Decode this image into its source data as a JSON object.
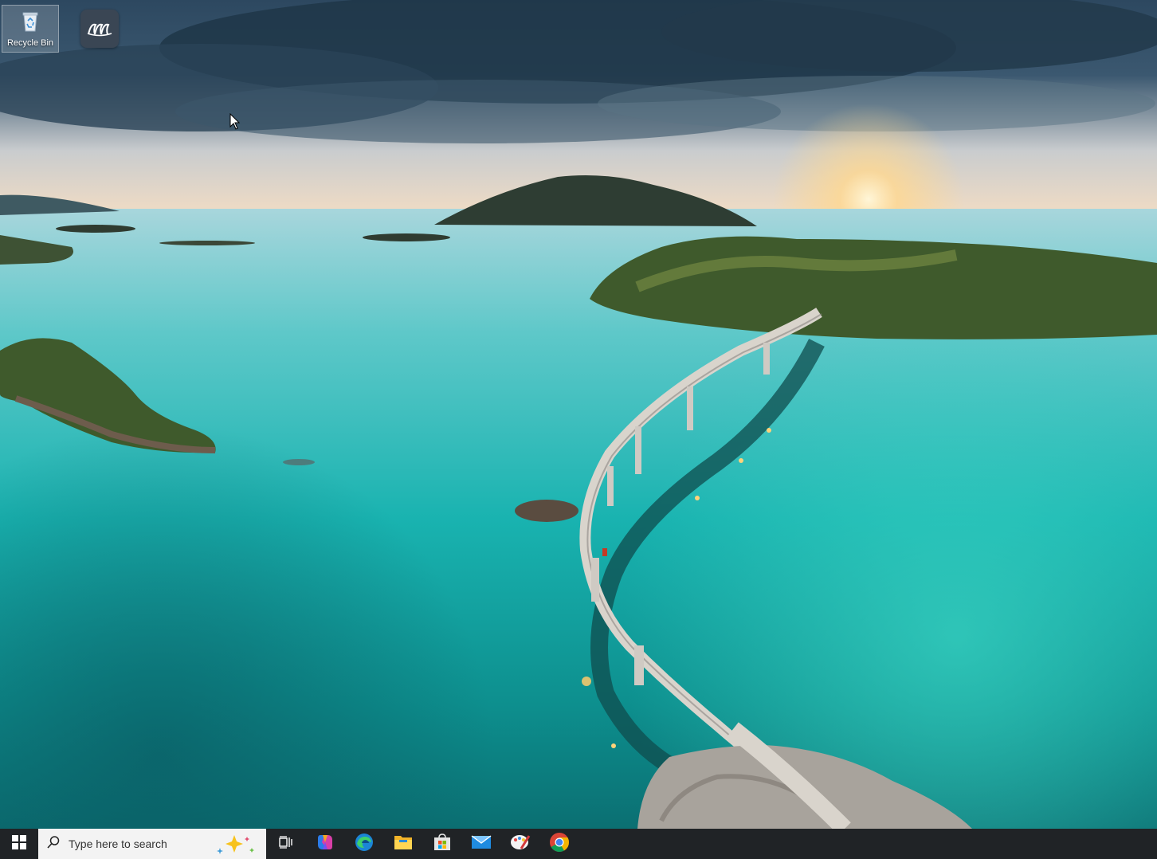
{
  "desktop": {
    "icons": [
      {
        "label": "Recycle Bin",
        "icon": "recycle-bin-icon"
      },
      {
        "label": "",
        "icon": "app-waves-icon"
      }
    ],
    "wallpaper": "coastal bridge over turquoise water at sunset"
  },
  "taskbar": {
    "search": {
      "placeholder": "Type here to search"
    },
    "apps": [
      {
        "name": "Copilot",
        "icon": "copilot-icon"
      },
      {
        "name": "Microsoft Edge",
        "icon": "edge-icon"
      },
      {
        "name": "File Explorer",
        "icon": "file-explorer-icon"
      },
      {
        "name": "Microsoft Store",
        "icon": "store-icon"
      },
      {
        "name": "Mail",
        "icon": "mail-icon"
      },
      {
        "name": "Paint",
        "icon": "paint-icon"
      },
      {
        "name": "Google Chrome",
        "icon": "chrome-icon"
      }
    ],
    "colors": {
      "background": "#202326",
      "search_bg": "#f3f3f3",
      "accent": "#0078d4"
    }
  }
}
